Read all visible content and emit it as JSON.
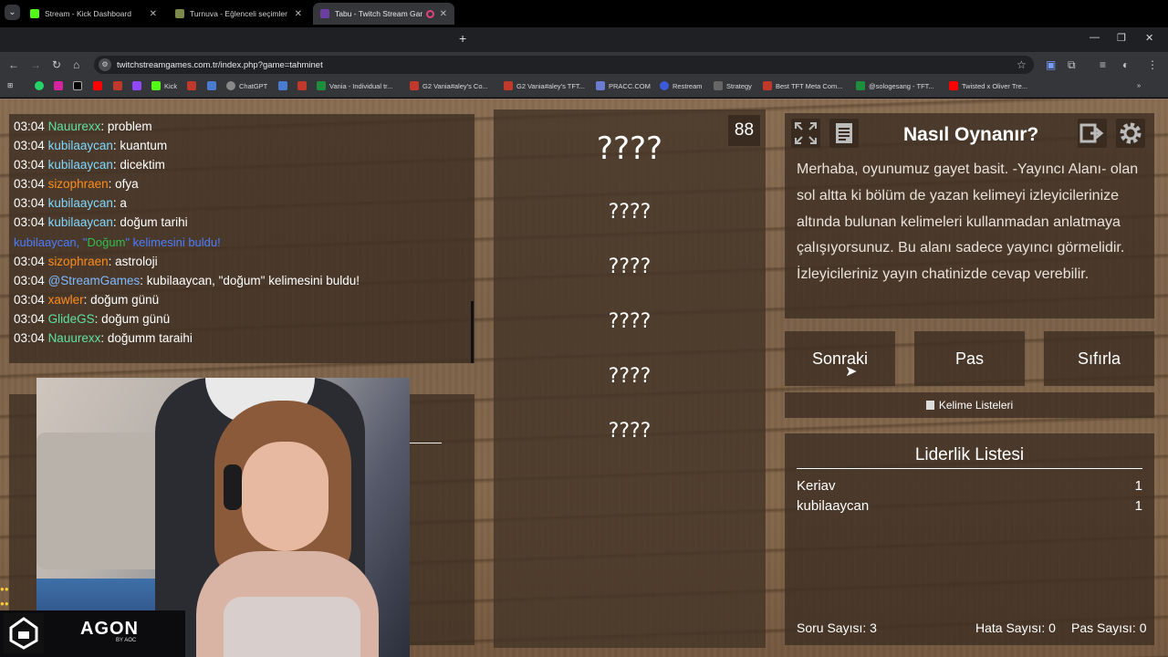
{
  "browser": {
    "tabs": [
      {
        "title": "Stream - Kick Dashboard",
        "fav": "#53fc18"
      },
      {
        "title": "Turnuva - Eğlenceli seçimler ya",
        "fav": "#7b8a4a"
      },
      {
        "title": "Tabu - Twitch Stream Games",
        "fav": "#6b3fa0"
      }
    ],
    "url": "twitchstreamgames.com.tr/index.php?game=tahminet",
    "bookmarks": [
      "Kick",
      "ChatGPT",
      "Vania - Individual tr...",
      "G2 Vania#aley's Co...",
      "G2 Vania#aley's TFT...",
      "PRACC.COM",
      "Restream",
      "Strategy",
      "Best TFT Meta Com...",
      "@sologesang - TFT...",
      "Twisted x Oliver Tre..."
    ]
  },
  "chat": {
    "messages": [
      {
        "time": "03:04",
        "user": "Nauurexx",
        "color": "#5ee0a0",
        "text": ": problem"
      },
      {
        "time": "03:04",
        "user": "kubilaaycan",
        "color": "#7fd8ff",
        "text": ": kuantum"
      },
      {
        "time": "03:04",
        "user": "kubilaaycan",
        "color": "#7fd8ff",
        "text": ": dicektim"
      },
      {
        "time": "03:04",
        "user": "sizophraen",
        "color": "#ff8c1a",
        "text": ": ofya"
      },
      {
        "time": "03:04",
        "user": "kubilaaycan",
        "color": "#7fd8ff",
        "text": ": a"
      },
      {
        "time": "03:04",
        "user": "kubilaaycan",
        "color": "#7fd8ff",
        "text": ": doğum tarihi"
      },
      {
        "time": "03:04",
        "user": "sizophraen",
        "color": "#ff8c1a",
        "text": ": astroloji"
      },
      {
        "time": "03:04",
        "user": "@StreamGames",
        "color": "#7fb8ff",
        "text": ": kubilaaycan, \"doğum\" kelimesini buldu!"
      },
      {
        "time": "03:04",
        "user": "xawler",
        "color": "#ff8c1a",
        "text": ": doğum günü"
      },
      {
        "time": "03:04",
        "user": "GlideGS",
        "color": "#5ee0a0",
        "text": ": doğum günü"
      },
      {
        "time": "03:04",
        "user": "Nauurexx",
        "color": "#5ee0a0",
        "text": ": doğumm taraihi"
      }
    ],
    "system": {
      "pre": "kubilaaycan, \"",
      "word": "Doğum",
      "post": "\" kelimesini buldu!"
    }
  },
  "game": {
    "timer": "88",
    "main_word": "????",
    "taboo_words": [
      "????",
      "????",
      "????",
      "????",
      "????"
    ]
  },
  "howto": {
    "title": "Nasıl Oynanır?",
    "text": "Merhaba, oyunumuz gayet basit. -Yayıncı Alanı- olan sol altta ki bölüm de yazan kelimeyi izleyicilerinize altında bulunan kelimeleri kullanmadan anlatmaya çalışıyorsunuz. Bu alanı sadece yayıncı görmelidir. İzleyicileriniz yayın chatinizde cevap verebilir."
  },
  "buttons": {
    "next": "Sonraki",
    "pass": "Pas",
    "reset": "Sıfırla",
    "lists": "Kelime Listeleri"
  },
  "leaderboard": {
    "title": "Liderlik Listesi",
    "rows": [
      {
        "name": "Keriav",
        "score": "1"
      },
      {
        "name": "kubilaaycan",
        "score": "1"
      }
    ],
    "question_count": "Soru Sayısı: 3",
    "error_count": "Hata Sayısı: 0",
    "pass_count": "Pas Sayısı: 0"
  },
  "overlay": {
    "brand": "AGON",
    "sub": "BY AOC"
  }
}
